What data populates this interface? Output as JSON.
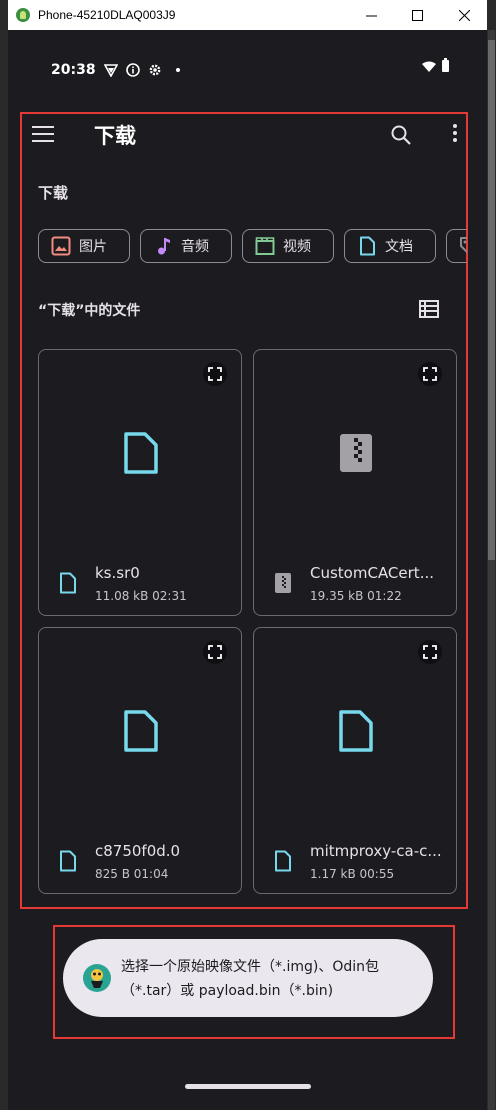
{
  "window": {
    "title": "Phone-45210DLAQ003J9"
  },
  "status_bar": {
    "time": "20:38"
  },
  "appbar": {
    "title": "下载"
  },
  "section": {
    "title": "下载"
  },
  "chips": [
    {
      "label": "图片",
      "icon": "image-icon",
      "color": "#f28b82"
    },
    {
      "label": "音频",
      "icon": "music-note-icon",
      "color": "#c58af9"
    },
    {
      "label": "视频",
      "icon": "clapperboard-icon",
      "color": "#81c995"
    },
    {
      "label": "文档",
      "icon": "document-icon",
      "color": "#78d9ec"
    },
    {
      "label": "",
      "icon": "tag-icon",
      "color": "#8f8a91"
    }
  ],
  "files_header": "“下载”中的文件",
  "files": [
    {
      "name": "ks.sr0",
      "meta": "11.08 kB 02:31",
      "icon": "document-icon",
      "color": "#78d9ec"
    },
    {
      "name": "CustomCACert...",
      "meta": "19.35 kB 01:22",
      "icon": "archive-icon",
      "color": "#a3a0a6"
    },
    {
      "name": "c8750f0d.0",
      "meta": "825 B 01:04",
      "icon": "document-icon",
      "color": "#78d9ec"
    },
    {
      "name": "mitmproxy-ca-c...",
      "meta": "1.17 kB 00:55",
      "icon": "document-icon",
      "color": "#78d9ec"
    }
  ],
  "toast": {
    "text": "选择一个原始映像文件（*.img)、Odin包（*.tar）或 payload.bin（*.bin)"
  }
}
